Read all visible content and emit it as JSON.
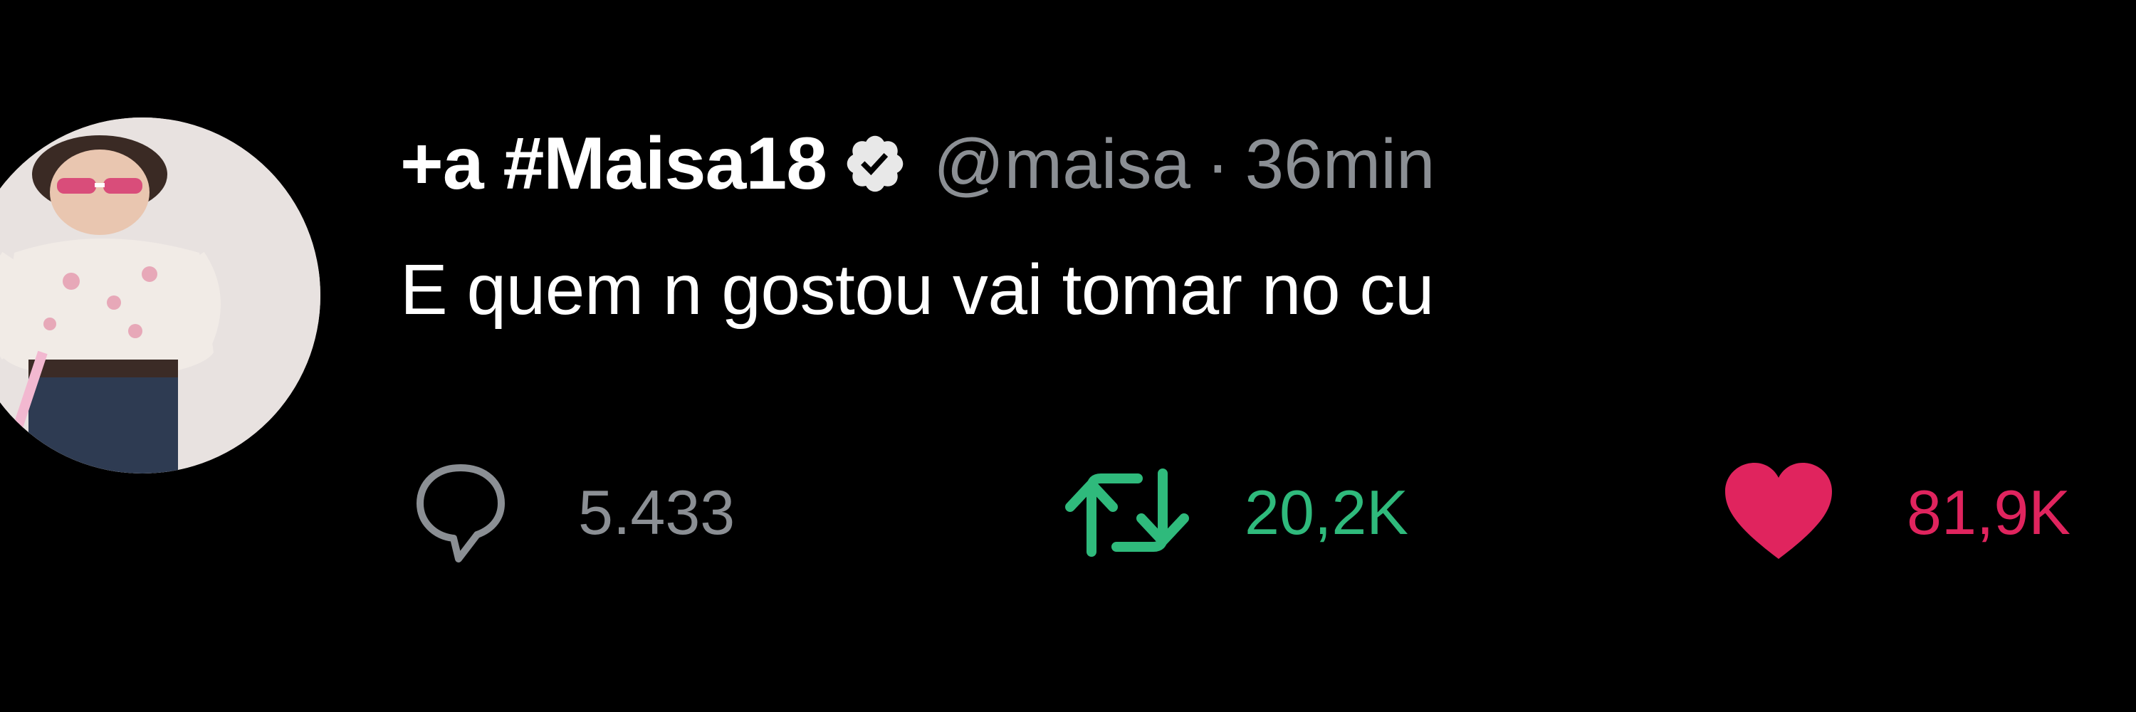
{
  "tweet": {
    "display_name": "+a #Maisa18",
    "verified": true,
    "handle": "@maisa",
    "separator": "·",
    "time": "36min",
    "text": "E quem n gostou vai tomar no cu"
  },
  "actions": {
    "reply": {
      "icon": "reply-bubble-icon",
      "count": "5.433",
      "color": "#8b8f94"
    },
    "retweet": {
      "icon": "retweet-icon",
      "count": "20,2K",
      "color": "#2fba7c",
      "active": true
    },
    "like": {
      "icon": "heart-icon",
      "count": "81,9K",
      "color": "#e0245e",
      "active": true
    }
  },
  "colors": {
    "background": "#000000",
    "primary_text": "#ffffff",
    "secondary_text": "#8b8f94"
  }
}
